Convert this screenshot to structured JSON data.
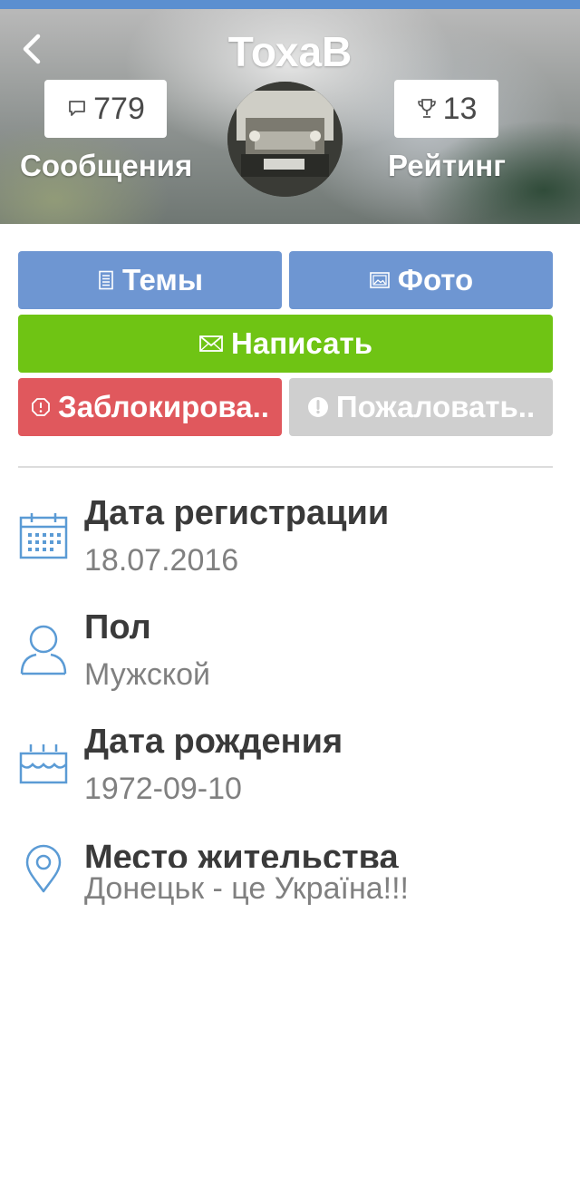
{
  "header": {
    "title": "ТохаВ",
    "messages": {
      "count": "779",
      "label": "Сообщения"
    },
    "rating": {
      "count": "13",
      "label": "Рейтинг"
    }
  },
  "buttons": {
    "topics": "Темы",
    "photo": "Фото",
    "write": "Написать",
    "block": "Заблокирова..",
    "report": "Пожаловать.."
  },
  "info": {
    "registration": {
      "title": "Дата регистрации",
      "value": "18.07.2016"
    },
    "gender": {
      "title": "Пол",
      "value": "Мужской"
    },
    "birthday": {
      "title": "Дата рождения",
      "value": "1972-09-10"
    },
    "location": {
      "title": "Место жительства",
      "value": "Донецьк - це Україна!!!"
    }
  },
  "colors": {
    "primary_blue": "#6e96d2",
    "write_green": "#6fc414",
    "block_red": "#e0585d",
    "report_gray": "#cfcfcf",
    "icon_blue": "#5b9bd5"
  },
  "icons": {
    "back": "back-arrow-icon",
    "messages": "speech-bubble-icon",
    "rating": "trophy-icon",
    "topics": "document-icon",
    "photo": "image-icon",
    "write": "envelope-icon",
    "block": "block-icon",
    "report": "exclamation-icon",
    "registration": "calendar-icon",
    "gender": "user-icon",
    "birthday": "birthday-cake-icon",
    "location": "location-pin-icon"
  }
}
